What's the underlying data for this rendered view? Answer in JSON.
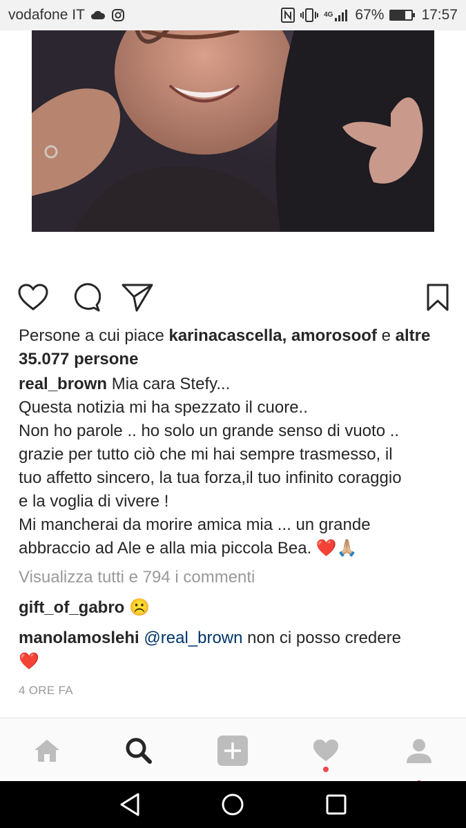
{
  "status_bar": {
    "carrier": "vodafone IT",
    "network": "4G",
    "battery": "67%",
    "battery_level": 0.67,
    "time": "17:57"
  },
  "post": {
    "likes": {
      "prefix": "Persone a cui piace ",
      "user1": "karinacascella",
      "separator": ", ",
      "user2": "amorosoof",
      "and": " e ",
      "others": "altre 35.077 persone"
    },
    "caption": {
      "username": "real_brown",
      "lines": [
        "Mia cara Stefy...",
        "Questa notizia mi ha spezzato il cuore..",
        "Non ho parole .. ho solo un grande senso di vuoto ..",
        "grazie per tutto ciò che mi hai sempre trasmesso, il",
        "tuo affetto sincero, la tua forza,il tuo infinito coraggio",
        "e la voglia di vivere !",
        "Mi mancherai da morire amica mia ... un grande",
        "abbraccio ad Ale e alla mia piccola Bea. ❤️🙏🏼"
      ]
    },
    "view_all_comments": "Visualizza tutti e 794 i commenti",
    "comments": [
      {
        "username": "gift_of_gabro",
        "text": "☹️"
      },
      {
        "username": "manolamoslehi",
        "mention": "@real_brown",
        "text": " non ci posso credere",
        "text2": "❤️"
      }
    ],
    "timestamp": "4 ORE FA"
  },
  "colors": {
    "accent_red": "#ed4956",
    "mention_blue": "#003569",
    "muted_gray": "#999999"
  }
}
